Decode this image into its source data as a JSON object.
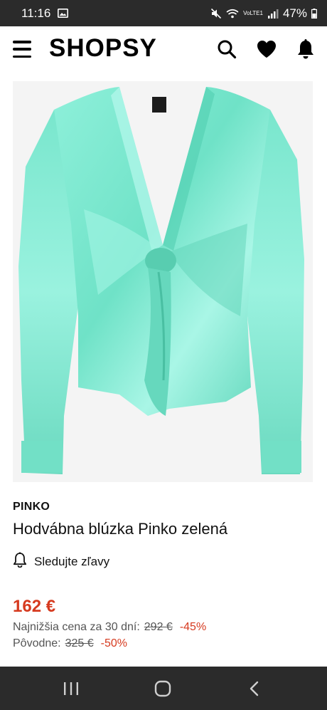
{
  "status_bar": {
    "time": "11:16",
    "battery": "47%",
    "network": "VoLTE1"
  },
  "header": {
    "logo": "SHOPSY",
    "icons": [
      "menu-icon",
      "search-icon",
      "heart-icon",
      "bell-icon"
    ]
  },
  "product": {
    "image_alt": "product-photo",
    "brand": "PINKO",
    "title": "Hodvábna blúzka Pinko zelená",
    "watch_label": "Sledujte zľavy",
    "price": "162 €",
    "lowest_30": {
      "label": "Najnižšia cena za 30 dní:",
      "old": "292 €",
      "discount": "-45%"
    },
    "original": {
      "label": "Pôvodne:",
      "old": "325 €",
      "discount": "-50%"
    }
  },
  "nav": {
    "icons": [
      "recents-icon",
      "home-icon",
      "back-icon"
    ]
  },
  "colors": {
    "accent": "#d63a1f",
    "bars": "#2b2b2b",
    "product": "#7ee8d0"
  }
}
